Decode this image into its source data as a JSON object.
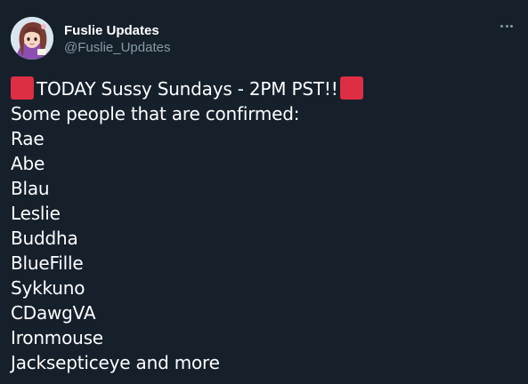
{
  "author": {
    "display_name": "Fuslie Updates",
    "handle": "@Fuslie_Updates",
    "avatar_icon": "anime-girl-avatar"
  },
  "menu": {
    "icon": "more-horizontal-icon"
  },
  "tweet": {
    "headline": "TODAY Sussy Sundays - 2PM PST!!",
    "headline_emoji": "red-square-emoji",
    "intro": "Some people that are confirmed:",
    "people": [
      "Rae",
      "Abe",
      "Blau",
      "Leslie",
      "Buddha",
      "BlueFille",
      "Sykkuno",
      "CDawgVA",
      "Ironmouse",
      "Jacksepticeye and more"
    ]
  },
  "colors": {
    "background": "#15202b",
    "text": "#ffffff",
    "secondary_text": "#8899a6",
    "emoji_red": "#dd2e44"
  }
}
